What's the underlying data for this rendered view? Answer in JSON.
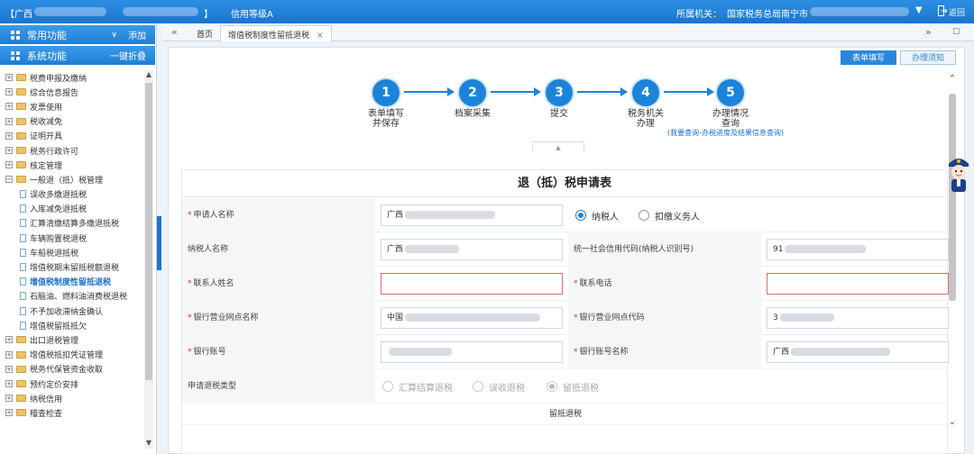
{
  "topbar": {
    "region": "【广西",
    "region_end": "】",
    "credit": "信用等级A",
    "office_label": "所属机关：",
    "office": "国家税务总局南宁市",
    "back": "返回"
  },
  "sidebar": {
    "common": "常用功能",
    "common_action": "添加",
    "system": "系统功能",
    "system_action": "一键折叠",
    "items": [
      {
        "label": "税费申报及缴纳",
        "type": "folder"
      },
      {
        "label": "综合信息报告",
        "type": "folder"
      },
      {
        "label": "发票使用",
        "type": "folder"
      },
      {
        "label": "税收减免",
        "type": "folder"
      },
      {
        "label": "证明开具",
        "type": "folder"
      },
      {
        "label": "税务行政许可",
        "type": "folder"
      },
      {
        "label": "核定管理",
        "type": "folder"
      },
      {
        "label": "一般退（抵）税管理",
        "type": "open"
      },
      {
        "label": "误收多缴退抵税",
        "type": "leaf"
      },
      {
        "label": "入库减免退抵税",
        "type": "leaf"
      },
      {
        "label": "汇算清缴结算多缴退抵税",
        "type": "leaf"
      },
      {
        "label": "车辆购置税退税",
        "type": "leaf"
      },
      {
        "label": "车船税退抵税",
        "type": "leaf"
      },
      {
        "label": "增值税期末留抵税额退税",
        "type": "leaf"
      },
      {
        "label": "增值税制度性留抵退税",
        "type": "leaf-active"
      },
      {
        "label": "石脑油、燃料油消费税退税",
        "type": "leaf"
      },
      {
        "label": "不予加收滞纳金确认",
        "type": "leaf"
      },
      {
        "label": "增值税留抵抵欠",
        "type": "leaf"
      },
      {
        "label": "出口退税管理",
        "type": "folder"
      },
      {
        "label": "增值税抵扣凭证管理",
        "type": "folder"
      },
      {
        "label": "税务代保管资金收取",
        "type": "folder"
      },
      {
        "label": "预约定价安排",
        "type": "folder"
      },
      {
        "label": "纳税信用",
        "type": "folder"
      },
      {
        "label": "稽查检查",
        "type": "folder"
      }
    ]
  },
  "tabs": {
    "home": "首页",
    "current": "增值税制度性留抵退税"
  },
  "mode_tabs": {
    "fill": "表单填写",
    "notice": "办理须知"
  },
  "steps": [
    {
      "num": "1",
      "label": "表单填写\n并保存",
      "sub": ""
    },
    {
      "num": "2",
      "label": "档案采集",
      "sub": ""
    },
    {
      "num": "3",
      "label": "提交",
      "sub": ""
    },
    {
      "num": "4",
      "label": "税务机关\n办理",
      "sub": ""
    },
    {
      "num": "5",
      "label": "办理情况\n查询",
      "sub": "(我要查询-办税进度及结果信息查询)"
    }
  ],
  "form": {
    "title": "退（抵）税申请表",
    "applicant_label": "申请人名称",
    "applicant_value": "广西",
    "role_taxpayer": "纳税人",
    "role_withholder": "扣缴义务人",
    "taxpayer_label": "纳税人名称",
    "taxpayer_value": "广西",
    "credit_code_label": "统一社会信用代码(纳税人识别号)",
    "credit_code_value": "91",
    "contact_label": "联系人姓名",
    "contact_value": "",
    "phone_label": "联系电话",
    "phone_value": "",
    "bank_branch_label": "银行营业网点名称",
    "bank_branch_value": "中国",
    "bank_code_label": "银行营业网点代码",
    "bank_code_value": "3",
    "bank_account_label": "银行账号",
    "bank_account_value": "",
    "account_name_label": "银行账号名称",
    "account_name_value": "广西",
    "refund_type_label": "申请退税类型",
    "refund_types": [
      "汇算结算退税",
      "误收退税",
      "留抵退税"
    ],
    "section_label": "留抵退税"
  }
}
